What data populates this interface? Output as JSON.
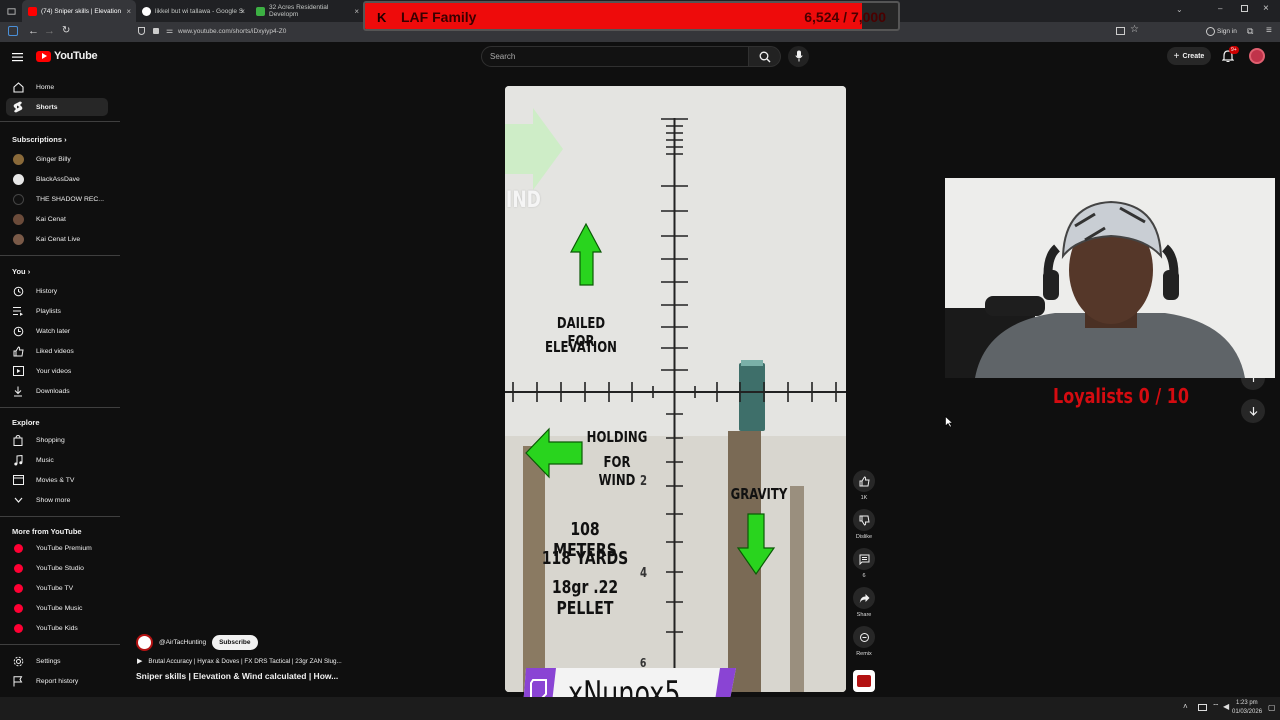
{
  "browser": {
    "tabs": [
      {
        "title": "(74) Sniper skills | Elevation",
        "active": true
      },
      {
        "title": "likkel but wi tallawa - Google S",
        "active": false
      },
      {
        "title": "32 Acres Residential Developm",
        "active": false
      }
    ],
    "url": "www.youtube.com/shorts/iDxyiyp4-Z0",
    "sign_in": "Sign in"
  },
  "youtube": {
    "logo": "YouTube",
    "search_placeholder": "Search",
    "create_label": "Create",
    "notifications_badge": "9+"
  },
  "sidebar": {
    "main": [
      {
        "label": "Home",
        "icon": "home-icon"
      },
      {
        "label": "Shorts",
        "icon": "shorts-icon",
        "active": true
      }
    ],
    "subscriptions_title": "Subscriptions",
    "subscriptions": [
      {
        "label": "Ginger Billy",
        "color": "#8a6a3a"
      },
      {
        "label": "BlackAssDave",
        "color": "#e8e8e8"
      },
      {
        "label": "THE SHADOW REC...",
        "color": "#111111"
      },
      {
        "label": "Kai Cenat",
        "color": "#6b4b3a"
      },
      {
        "label": "Kai Cenat Live",
        "color": "#7a5a48"
      }
    ],
    "you_title": "You",
    "you": [
      {
        "label": "History",
        "icon": "history-icon"
      },
      {
        "label": "Playlists",
        "icon": "playlists-icon"
      },
      {
        "label": "Watch later",
        "icon": "watch-later-icon"
      },
      {
        "label": "Liked videos",
        "icon": "liked-videos-icon"
      },
      {
        "label": "Your videos",
        "icon": "your-videos-icon"
      },
      {
        "label": "Downloads",
        "icon": "downloads-icon"
      }
    ],
    "explore_title": "Explore",
    "explore": [
      {
        "label": "Shopping",
        "icon": "shopping-icon"
      },
      {
        "label": "Music",
        "icon": "music-icon"
      },
      {
        "label": "Movies & TV",
        "icon": "movies-icon"
      },
      {
        "label": "Show more",
        "icon": "chevron-down-icon"
      }
    ],
    "more_title": "More from YouTube",
    "more": [
      {
        "label": "YouTube Premium"
      },
      {
        "label": "YouTube Studio"
      },
      {
        "label": "YouTube TV"
      },
      {
        "label": "YouTube Music"
      },
      {
        "label": "YouTube Kids"
      }
    ],
    "bottom": [
      {
        "label": "Settings",
        "icon": "settings-icon"
      },
      {
        "label": "Report history",
        "icon": "flag-icon"
      }
    ]
  },
  "video": {
    "wind_label": "IND",
    "elevation_label_1": "DAILED FOR",
    "elevation_label_2": "ELEVATION",
    "wind_hold_1": "HOLDING",
    "wind_hold_2": "FOR WIND",
    "gravity": "GRAVITY",
    "info_1": "108 METERS",
    "info_2": "118 YARDS",
    "info_3": "18gr .22 PELLET",
    "reticle_2": "2",
    "reticle_4": "4",
    "reticle_6": "6"
  },
  "actions": {
    "like_count": "1K",
    "dislike": "Dislike",
    "comments": "6",
    "share": "Share",
    "remix": "Remix"
  },
  "channel": {
    "handle": "@AirTacHunting",
    "subscribe": "Subscribe",
    "playlist": "Brutal Accuracy | Hyrax & Doves | FX DRS Tactical | 23gr ZAN Slug...",
    "title": "Sniper skills | Elevation & Wind calculated | How..."
  },
  "stream": {
    "goal_name": "LAF Family",
    "goal_value": "6,524 / 7,000",
    "goal_progress": 0.932,
    "loyalists": "Loyalists  0 / 10",
    "twitch_name": "xNunox5"
  },
  "taskbar": {
    "time": "1:23 pm",
    "date": "01/03/2026"
  }
}
